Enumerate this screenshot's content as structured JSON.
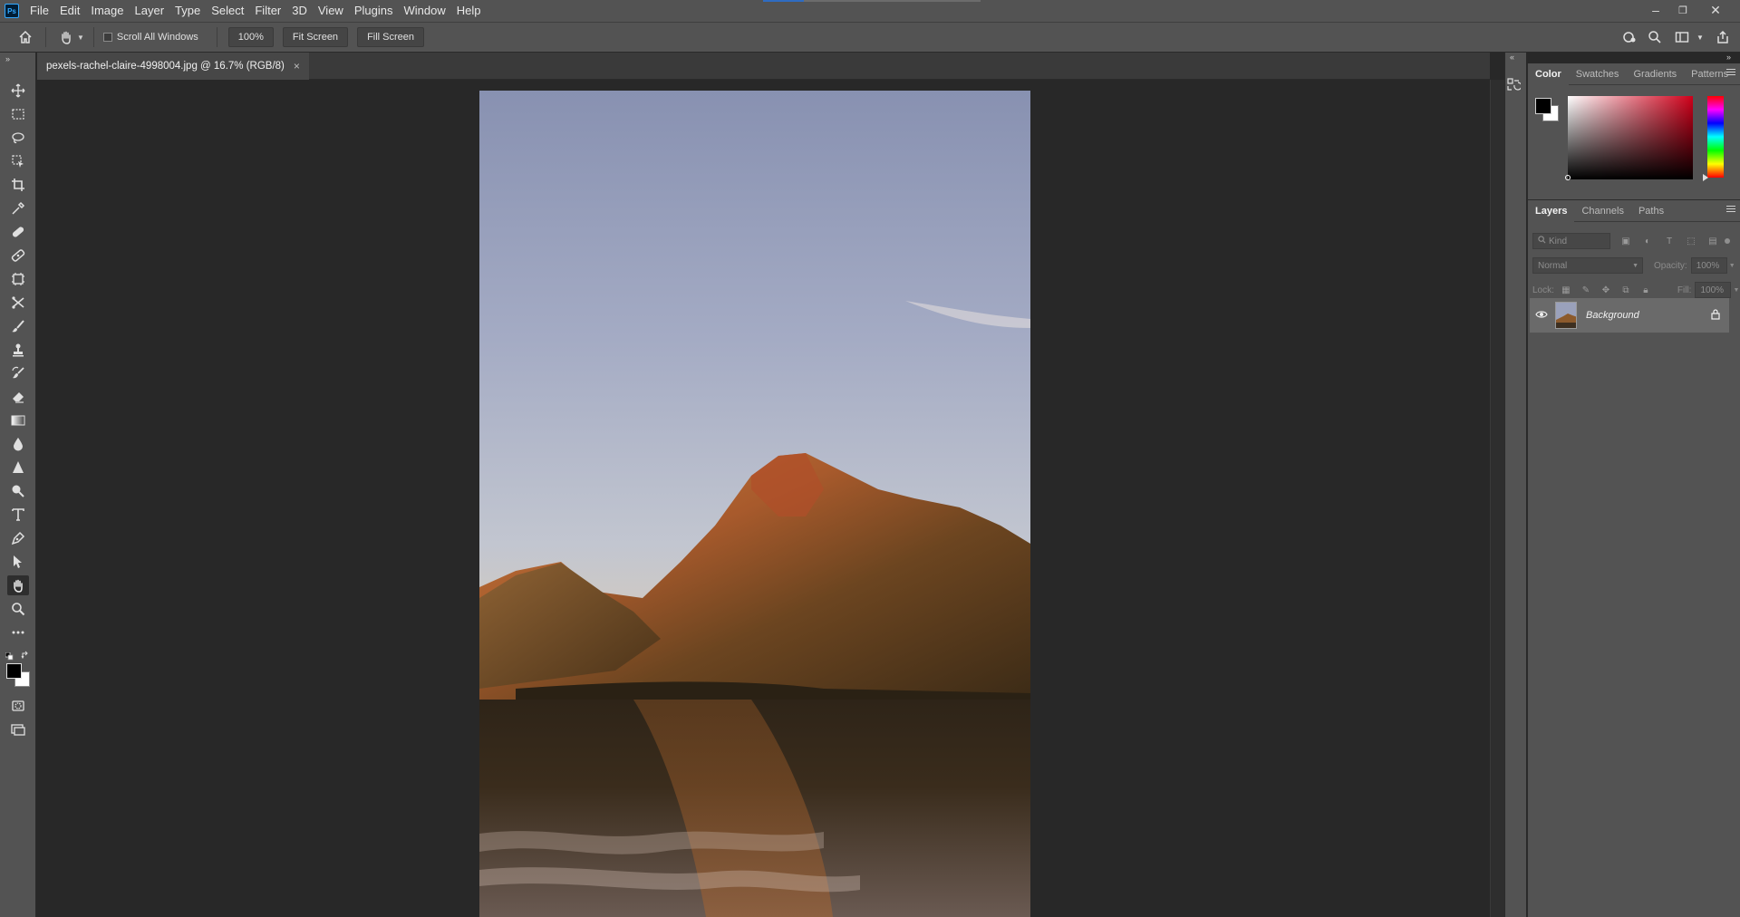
{
  "app": {
    "logo": "Ps",
    "menu": [
      "File",
      "Edit",
      "Image",
      "Layer",
      "Type",
      "Select",
      "Filter",
      "3D",
      "View",
      "Plugins",
      "Window",
      "Help"
    ]
  },
  "window_controls": {
    "minimize": "–",
    "restore": "❐",
    "close": "✕"
  },
  "options_bar": {
    "scroll_all_windows_label": "Scroll All Windows",
    "zoom_button": "100%",
    "fit_screen_button": "Fit Screen",
    "fill_screen_button": "Fill Screen"
  },
  "document": {
    "tab_title": "pexels-rachel-claire-4998004.jpg @ 16.7% (RGB/8)",
    "close_glyph": "×"
  },
  "tools": [
    "move-tool-icon",
    "rectangular-marquee-icon",
    "lasso-icon",
    "object-selection-icon",
    "crop-icon",
    "eyedropper-icon",
    "spot-healing-icon",
    "healing-brush-icon",
    "frame-tool-icon",
    "content-aware-move-icon",
    "brush-icon",
    "clone-stamp-icon",
    "history-brush-icon",
    "eraser-icon",
    "gradient-icon",
    "blur-drop-icon",
    "sharpen-triangle-icon",
    "dodge-icon",
    "type-icon",
    "pen-icon",
    "path-selection-icon",
    "hand-icon",
    "zoom-icon",
    "more-tools-icon"
  ],
  "color_panel": {
    "tabs": [
      "Color",
      "Swatches",
      "Gradients",
      "Patterns"
    ],
    "active_tab": "Color",
    "foreground": "#000000",
    "background": "#ffffff",
    "field_hue": "#d0001a"
  },
  "layers_panel": {
    "tabs": [
      "Layers",
      "Channels",
      "Paths"
    ],
    "active_tab": "Layers",
    "filter_placeholder": "Kind",
    "blend_mode": "Normal",
    "opacity_label": "Opacity:",
    "opacity_value": "100%",
    "lock_label": "Lock:",
    "fill_label": "Fill:",
    "fill_value": "100%",
    "layers": [
      {
        "name": "Background",
        "visible": true,
        "locked": true
      }
    ]
  }
}
